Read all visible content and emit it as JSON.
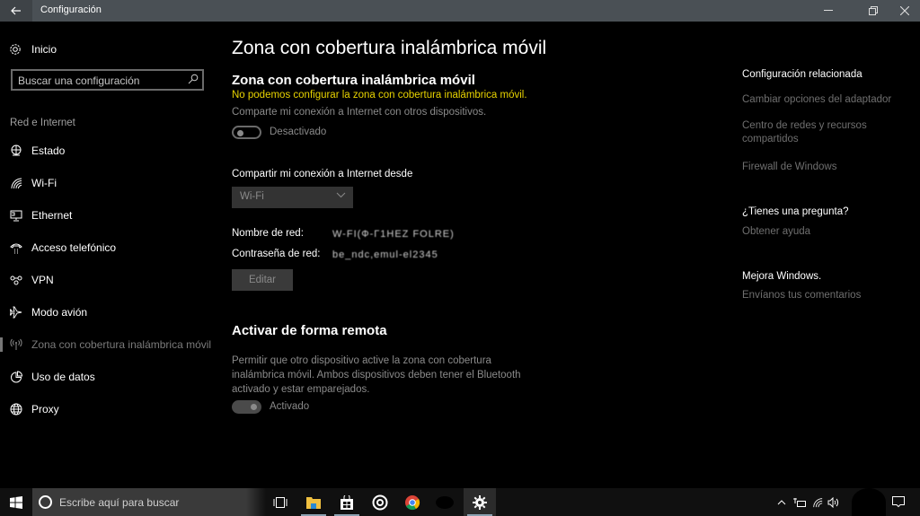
{
  "window": {
    "title": "Configuración",
    "controls": {
      "minimize": "minimize-icon",
      "maximize": "restore-icon",
      "close": "close-icon"
    }
  },
  "sidebar": {
    "home_label": "Inicio",
    "search_placeholder": "Buscar una configuración",
    "section_header": "Red e Internet",
    "items": [
      {
        "label": "Estado",
        "icon": "globe-status-icon"
      },
      {
        "label": "Wi-Fi",
        "icon": "wifi-icon"
      },
      {
        "label": "Ethernet",
        "icon": "ethernet-icon"
      },
      {
        "label": "Acceso telefónico",
        "icon": "dialup-phone-icon"
      },
      {
        "label": "VPN",
        "icon": "vpn-icon"
      },
      {
        "label": "Modo avión",
        "icon": "airplane-icon"
      },
      {
        "label": "Zona con cobertura inalámbrica móvil",
        "icon": "hotspot-icon",
        "active": true
      },
      {
        "label": "Uso de datos",
        "icon": "data-usage-icon"
      },
      {
        "label": "Proxy",
        "icon": "globe-icon"
      }
    ]
  },
  "main": {
    "page_title": "Zona con cobertura inalámbrica móvil",
    "hotspot": {
      "title": "Zona con cobertura inalámbrica móvil",
      "warning": "No podemos configurar la zona con cobertura inalámbrica móvil.",
      "description": "Comparte mi conexión a Internet con otros dispositivos.",
      "toggle_state": "off",
      "toggle_label": "Desactivado"
    },
    "share_from": {
      "label": "Compartir mi conexión a Internet desde",
      "selected": "Wi-Fi"
    },
    "network_name": {
      "label": "Nombre de red:",
      "value": "W-FI(Ф-Г1HEZ FOLRE)"
    },
    "network_password": {
      "label": "Contraseña de red:",
      "value": "be_ndc,emul-el2345"
    },
    "edit_button": "Editar",
    "remote": {
      "title": "Activar de forma remota",
      "description": "Permitir que otro dispositivo active la zona con cobertura inalámbrica móvil. Ambos dispositivos deben tener el Bluetooth activado y estar emparejados.",
      "toggle_state": "on",
      "toggle_label": "Activado"
    }
  },
  "related": {
    "header": "Configuración relacionada",
    "links": [
      "Cambiar opciones del adaptador",
      "Centro de redes y recursos compartidos",
      "Firewall de Windows"
    ],
    "question_header": "¿Tienes una pregunta?",
    "help_link": "Obtener ayuda",
    "feedback_header": "Mejora Windows.",
    "feedback_link": "Envíanos tus comentarios"
  },
  "taskbar": {
    "search_placeholder": "Escribe aquí para buscar",
    "apps": [
      "task-view",
      "file-explorer",
      "store",
      "groove",
      "chrome",
      "redacted-app",
      "settings"
    ],
    "tray": [
      "show-hidden-icons",
      "network-device",
      "wifi",
      "volume",
      "action-center"
    ]
  }
}
